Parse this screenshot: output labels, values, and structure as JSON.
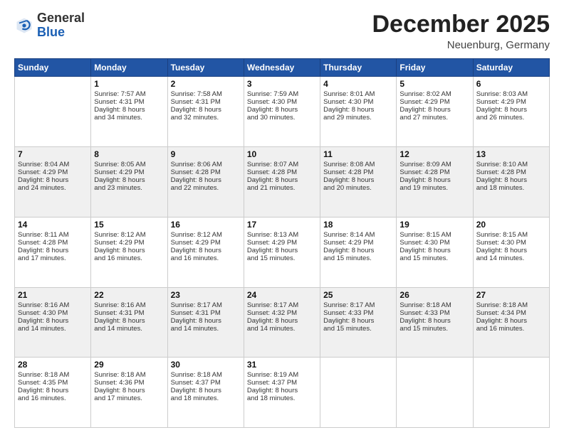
{
  "header": {
    "logo_general": "General",
    "logo_blue": "Blue",
    "month": "December 2025",
    "location": "Neuenburg, Germany"
  },
  "days_header": [
    "Sunday",
    "Monday",
    "Tuesday",
    "Wednesday",
    "Thursday",
    "Friday",
    "Saturday"
  ],
  "weeks": [
    [
      {
        "day": "",
        "info": ""
      },
      {
        "day": "1",
        "info": "Sunrise: 7:57 AM\nSunset: 4:31 PM\nDaylight: 8 hours\nand 34 minutes."
      },
      {
        "day": "2",
        "info": "Sunrise: 7:58 AM\nSunset: 4:31 PM\nDaylight: 8 hours\nand 32 minutes."
      },
      {
        "day": "3",
        "info": "Sunrise: 7:59 AM\nSunset: 4:30 PM\nDaylight: 8 hours\nand 30 minutes."
      },
      {
        "day": "4",
        "info": "Sunrise: 8:01 AM\nSunset: 4:30 PM\nDaylight: 8 hours\nand 29 minutes."
      },
      {
        "day": "5",
        "info": "Sunrise: 8:02 AM\nSunset: 4:29 PM\nDaylight: 8 hours\nand 27 minutes."
      },
      {
        "day": "6",
        "info": "Sunrise: 8:03 AM\nSunset: 4:29 PM\nDaylight: 8 hours\nand 26 minutes."
      }
    ],
    [
      {
        "day": "7",
        "info": "Sunrise: 8:04 AM\nSunset: 4:29 PM\nDaylight: 8 hours\nand 24 minutes."
      },
      {
        "day": "8",
        "info": "Sunrise: 8:05 AM\nSunset: 4:29 PM\nDaylight: 8 hours\nand 23 minutes."
      },
      {
        "day": "9",
        "info": "Sunrise: 8:06 AM\nSunset: 4:28 PM\nDaylight: 8 hours\nand 22 minutes."
      },
      {
        "day": "10",
        "info": "Sunrise: 8:07 AM\nSunset: 4:28 PM\nDaylight: 8 hours\nand 21 minutes."
      },
      {
        "day": "11",
        "info": "Sunrise: 8:08 AM\nSunset: 4:28 PM\nDaylight: 8 hours\nand 20 minutes."
      },
      {
        "day": "12",
        "info": "Sunrise: 8:09 AM\nSunset: 4:28 PM\nDaylight: 8 hours\nand 19 minutes."
      },
      {
        "day": "13",
        "info": "Sunrise: 8:10 AM\nSunset: 4:28 PM\nDaylight: 8 hours\nand 18 minutes."
      }
    ],
    [
      {
        "day": "14",
        "info": "Sunrise: 8:11 AM\nSunset: 4:28 PM\nDaylight: 8 hours\nand 17 minutes."
      },
      {
        "day": "15",
        "info": "Sunrise: 8:12 AM\nSunset: 4:29 PM\nDaylight: 8 hours\nand 16 minutes."
      },
      {
        "day": "16",
        "info": "Sunrise: 8:12 AM\nSunset: 4:29 PM\nDaylight: 8 hours\nand 16 minutes."
      },
      {
        "day": "17",
        "info": "Sunrise: 8:13 AM\nSunset: 4:29 PM\nDaylight: 8 hours\nand 15 minutes."
      },
      {
        "day": "18",
        "info": "Sunrise: 8:14 AM\nSunset: 4:29 PM\nDaylight: 8 hours\nand 15 minutes."
      },
      {
        "day": "19",
        "info": "Sunrise: 8:15 AM\nSunset: 4:30 PM\nDaylight: 8 hours\nand 15 minutes."
      },
      {
        "day": "20",
        "info": "Sunrise: 8:15 AM\nSunset: 4:30 PM\nDaylight: 8 hours\nand 14 minutes."
      }
    ],
    [
      {
        "day": "21",
        "info": "Sunrise: 8:16 AM\nSunset: 4:30 PM\nDaylight: 8 hours\nand 14 minutes."
      },
      {
        "day": "22",
        "info": "Sunrise: 8:16 AM\nSunset: 4:31 PM\nDaylight: 8 hours\nand 14 minutes."
      },
      {
        "day": "23",
        "info": "Sunrise: 8:17 AM\nSunset: 4:31 PM\nDaylight: 8 hours\nand 14 minutes."
      },
      {
        "day": "24",
        "info": "Sunrise: 8:17 AM\nSunset: 4:32 PM\nDaylight: 8 hours\nand 14 minutes."
      },
      {
        "day": "25",
        "info": "Sunrise: 8:17 AM\nSunset: 4:33 PM\nDaylight: 8 hours\nand 15 minutes."
      },
      {
        "day": "26",
        "info": "Sunrise: 8:18 AM\nSunset: 4:33 PM\nDaylight: 8 hours\nand 15 minutes."
      },
      {
        "day": "27",
        "info": "Sunrise: 8:18 AM\nSunset: 4:34 PM\nDaylight: 8 hours\nand 16 minutes."
      }
    ],
    [
      {
        "day": "28",
        "info": "Sunrise: 8:18 AM\nSunset: 4:35 PM\nDaylight: 8 hours\nand 16 minutes."
      },
      {
        "day": "29",
        "info": "Sunrise: 8:18 AM\nSunset: 4:36 PM\nDaylight: 8 hours\nand 17 minutes."
      },
      {
        "day": "30",
        "info": "Sunrise: 8:18 AM\nSunset: 4:37 PM\nDaylight: 8 hours\nand 18 minutes."
      },
      {
        "day": "31",
        "info": "Sunrise: 8:19 AM\nSunset: 4:37 PM\nDaylight: 8 hours\nand 18 minutes."
      },
      {
        "day": "",
        "info": ""
      },
      {
        "day": "",
        "info": ""
      },
      {
        "day": "",
        "info": ""
      }
    ]
  ]
}
